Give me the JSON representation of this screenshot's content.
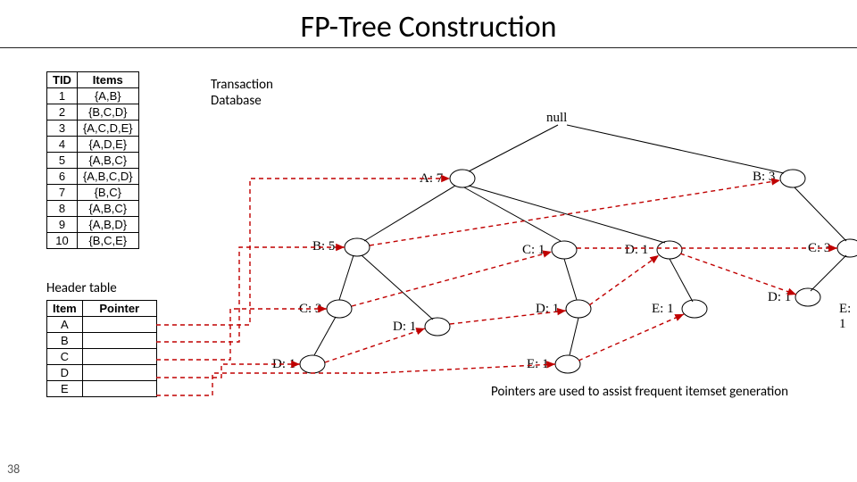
{
  "title": "FP-Tree Construction",
  "slide_number": "38",
  "txdb_label_1": "Transaction",
  "txdb_label_2": "Database",
  "header_label": "Header table",
  "note": "Pointers are used to assist frequent itemset generation",
  "tx_table": {
    "headers": [
      "TID",
      "Items"
    ],
    "rows": [
      [
        "1",
        "{A,B}"
      ],
      [
        "2",
        "{B,C,D}"
      ],
      [
        "3",
        "{A,C,D,E}"
      ],
      [
        "4",
        "{A,D,E}"
      ],
      [
        "5",
        "{A,B,C}"
      ],
      [
        "6",
        "{A,B,C,D}"
      ],
      [
        "7",
        "{B,C}"
      ],
      [
        "8",
        "{A,B,C}"
      ],
      [
        "9",
        "{A,B,D}"
      ],
      [
        "10",
        "{B,C,E}"
      ]
    ]
  },
  "header_table": {
    "headers": [
      "Item",
      "Pointer"
    ],
    "rows": [
      [
        "A",
        ""
      ],
      [
        "B",
        ""
      ],
      [
        "C",
        ""
      ],
      [
        "D",
        ""
      ],
      [
        "E",
        ""
      ]
    ]
  },
  "nodes": {
    "null": "null",
    "a7": "A: 7",
    "b3": "B: 3",
    "b5": "B: 5",
    "c1a": "C: 1",
    "d1a": "D: 1",
    "c3b": "C: 3",
    "c3": "C: 3",
    "d1b": "D: 1",
    "e1a": "E: 1",
    "d1c": "D: 1",
    "e1b": "E: 1",
    "d1d": "D: 1",
    "e1c": "E: 1",
    "d1e": "D: 1"
  }
}
